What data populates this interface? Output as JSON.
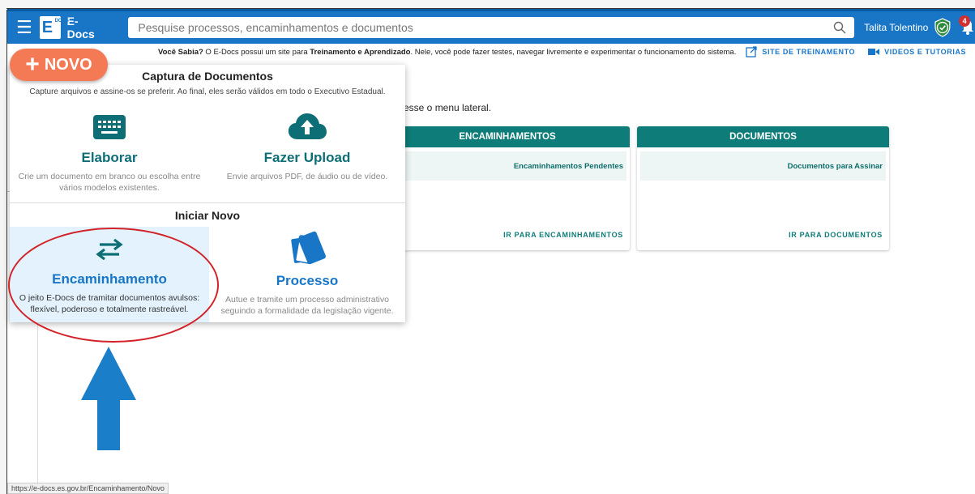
{
  "app": {
    "name": "E-Docs",
    "logo_letter": "E",
    "logo_sub": "DOCS"
  },
  "search": {
    "placeholder": "Pesquise processos, encaminhamentos e documentos"
  },
  "user": {
    "name": "Talita Tolentino",
    "notifications": "4"
  },
  "info": {
    "lead": "Você Sabia?",
    "text1": " O E-Docs possui um site para ",
    "bold2": "Treinamento e Aprendizado",
    "text2": ". Nele, você pode fazer testes, navegar livremente e experimentar o funcionamento do sistema.",
    "training_link": "SITE DE TREINAMENTO",
    "videos_link": "VIDEOS E TUTORIAS"
  },
  "novo_button": {
    "plus": "+",
    "label": "NOVO"
  },
  "menu": {
    "capture": {
      "title": "Captura de Documentos",
      "desc": "Capture arquivos e assine-os se preferir. Ao final, eles serão válidos em todo o Executivo Estadual.",
      "options": [
        {
          "title": "Elaborar",
          "desc_line1": "Crie um documento em branco ou escolha entre",
          "desc_line2": "vários modelos existentes.",
          "icon": "keyboard-icon"
        },
        {
          "title": "Fazer Upload",
          "desc_line1": "Envie arquivos PDF, de áudio ou de vídeo.",
          "desc_line2": "",
          "icon": "cloud-upload-icon"
        }
      ]
    },
    "start": {
      "title": "Iniciar Novo",
      "options": [
        {
          "title": "Encaminhamento",
          "desc_line1": "O jeito E-Docs de tramitar documentos avulsos:",
          "desc_line2": "flexível, poderoso e totalmente rastreável.",
          "icon": "swap-arrows-icon"
        },
        {
          "title": "Processo",
          "desc_line1": "Autue e tramite um processo administrativo",
          "desc_line2": "seguindo a formalidade da legislação vigente.",
          "icon": "folders-icon"
        }
      ]
    }
  },
  "background": {
    "hint": "cesse o menu lateral.",
    "cards": [
      {
        "header": "ENCAMINHAMENTOS",
        "row": "Encaminhamentos Pendentes",
        "link": "IR PARA ENCAMINHAMENTOS"
      },
      {
        "header": "DOCUMENTOS",
        "row": "Documentos para Assinar",
        "link": "IR PARA DOCUMENTOS"
      }
    ]
  },
  "status_url": "https://e-docs.es.gov.br/Encaminhamento/Novo",
  "colors": {
    "appbar": "#1976c7",
    "teal": "#0e7c78",
    "novo": "#f47a56",
    "annotation_red": "#d3232a",
    "annotation_arrow": "#1a7ec8"
  }
}
